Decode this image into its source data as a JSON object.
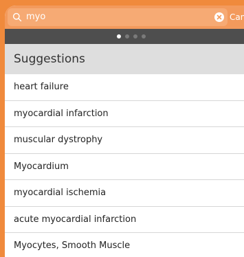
{
  "search": {
    "value": "myo",
    "cancel_label": "Can"
  },
  "pager": {
    "total": 4,
    "active_index": 0
  },
  "suggestions": {
    "title": "Suggestions",
    "items": [
      "heart failure",
      "myocardial infarction",
      "muscular dystrophy",
      "Myocardium",
      "myocardial ischemia",
      "acute myocardial infarction",
      "Myocytes, Smooth Muscle"
    ]
  },
  "colors": {
    "accent": "#f08a3c",
    "search_bar": "#f39a5c",
    "pager_strip": "#4e4e4e",
    "header_bg": "#dedede"
  },
  "icons": {
    "search": "search-icon",
    "clear": "clear-icon"
  }
}
